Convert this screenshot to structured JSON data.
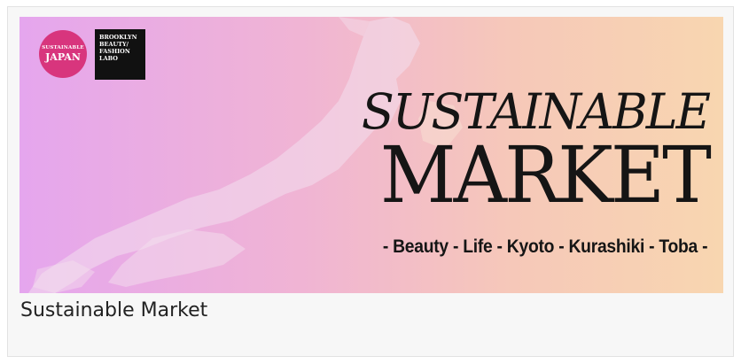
{
  "card": {
    "caption": "Sustainable Market"
  },
  "banner": {
    "logo_left": {
      "line1": "SUSTAINABLE",
      "line2": "JAPAN"
    },
    "logo_right": {
      "text": "BROOKLYN\nBEAUTY/\nFASHION\nLABO"
    },
    "headline": {
      "line1": "SUSTAINABLE",
      "line2": "MARKET"
    },
    "tagline": "- Beauty - Life - Kyoto - Kurashiki - Toba -"
  },
  "colors": {
    "gradient_left": "#e5a6ee",
    "gradient_right": "#f8d6b0",
    "logo_pink": "#d8357d",
    "logo_black": "#111111",
    "text_dark": "#151515"
  }
}
